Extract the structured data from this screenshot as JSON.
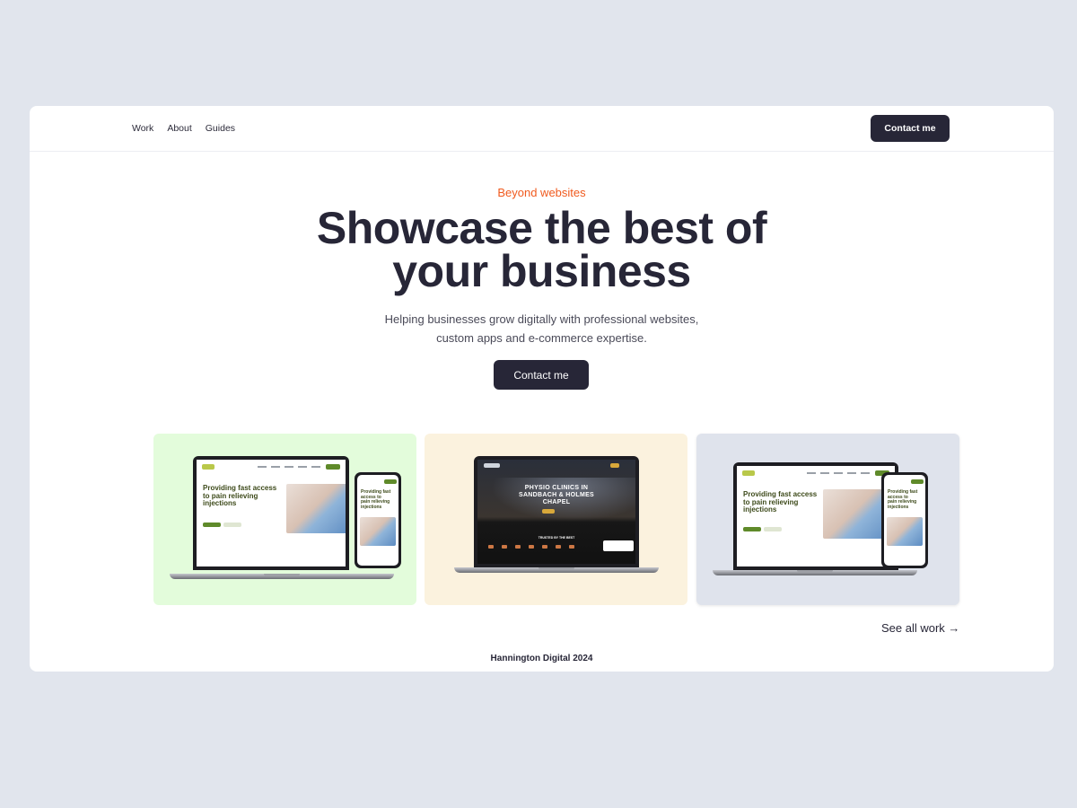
{
  "nav": {
    "links": [
      "Work",
      "About",
      "Guides"
    ],
    "cta_label": "Contact me"
  },
  "hero": {
    "eyebrow": "Beyond websites",
    "headline_lines": [
      "Showcase the best of",
      "your business"
    ],
    "subhead_lines": [
      "Helping businesses grow digitally with professional websites,",
      "custom apps and e-commerce expertise."
    ],
    "cta_label": "Contact me"
  },
  "work": {
    "cards": [
      {
        "background": "#e3fcdb",
        "laptop_title_lines": [
          "Providing fast access",
          "to pain relieving",
          "injections"
        ],
        "phone_title_lines": [
          "Providing fast access to",
          "pain relieving injections"
        ]
      },
      {
        "background": "#fbf2de",
        "laptop_title_lines": [
          "PHYSIO CLINICS IN",
          "SANDBACH & HOLMES",
          "CHAPEL"
        ],
        "laptop_caption": "TRUSTED BY THE BEST"
      },
      {
        "background": "#dfe3ec",
        "laptop_title_lines": [
          "Providing fast access",
          "to pain relieving",
          "injections"
        ],
        "phone_title_lines": [
          "Providing fast access to",
          "pain relieving injections"
        ]
      }
    ],
    "see_all_label": "See all work →"
  },
  "footer": {
    "text": "Hannington Digital 2024"
  },
  "colors": {
    "page_background": "#e1e5ed",
    "dark_button": "#272637",
    "accent": "#f05a1e"
  }
}
